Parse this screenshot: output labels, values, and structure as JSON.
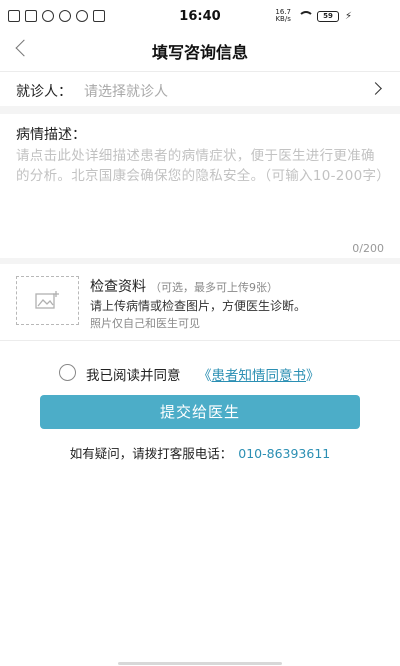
{
  "status_bar": {
    "time": "16:40",
    "net_speed_value": "16.7",
    "net_speed_unit": "KB/s",
    "battery": "59"
  },
  "header": {
    "title": "填写咨询信息"
  },
  "patient": {
    "label": "就诊人：",
    "placeholder": "请选择就诊人"
  },
  "description": {
    "label": "病情描述：",
    "placeholder": "请点击此处详细描述患者的病情症状，便于医生进行更准确的分析。北京国康会确保您的隐私安全。（可输入10-200字）",
    "counter": "0/200"
  },
  "upload": {
    "title": "检查资料",
    "hint": "（可选，最多可上传9张）",
    "subtitle": "请上传病情或检查图片，方便医生诊断。",
    "privacy": "照片仅自己和医生可见"
  },
  "agreement": {
    "text": "我已阅读并同意",
    "link_open": "《",
    "link_text": "患者知情同意书",
    "link_close": "》"
  },
  "submit": {
    "label": "提交给医生"
  },
  "hotline": {
    "text": "如有疑问，请拨打客服电话：",
    "number": "010-86393611"
  },
  "colors": {
    "accent": "#4cadc8",
    "link": "#2b8fb3"
  }
}
